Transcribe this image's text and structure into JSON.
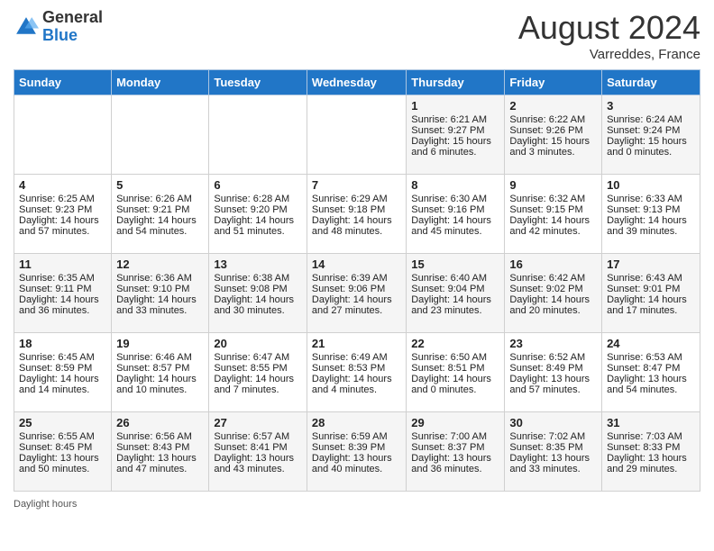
{
  "header": {
    "logo_general": "General",
    "logo_blue": "Blue",
    "month_title": "August 2024",
    "location": "Varreddes, France"
  },
  "days_of_week": [
    "Sunday",
    "Monday",
    "Tuesday",
    "Wednesday",
    "Thursday",
    "Friday",
    "Saturday"
  ],
  "weeks": [
    [
      {
        "day": "",
        "empty": true
      },
      {
        "day": "",
        "empty": true
      },
      {
        "day": "",
        "empty": true
      },
      {
        "day": "",
        "empty": true
      },
      {
        "day": "1",
        "sunrise": "Sunrise: 6:21 AM",
        "sunset": "Sunset: 9:27 PM",
        "daylight": "Daylight: 15 hours and 6 minutes."
      },
      {
        "day": "2",
        "sunrise": "Sunrise: 6:22 AM",
        "sunset": "Sunset: 9:26 PM",
        "daylight": "Daylight: 15 hours and 3 minutes."
      },
      {
        "day": "3",
        "sunrise": "Sunrise: 6:24 AM",
        "sunset": "Sunset: 9:24 PM",
        "daylight": "Daylight: 15 hours and 0 minutes."
      }
    ],
    [
      {
        "day": "4",
        "sunrise": "Sunrise: 6:25 AM",
        "sunset": "Sunset: 9:23 PM",
        "daylight": "Daylight: 14 hours and 57 minutes."
      },
      {
        "day": "5",
        "sunrise": "Sunrise: 6:26 AM",
        "sunset": "Sunset: 9:21 PM",
        "daylight": "Daylight: 14 hours and 54 minutes."
      },
      {
        "day": "6",
        "sunrise": "Sunrise: 6:28 AM",
        "sunset": "Sunset: 9:20 PM",
        "daylight": "Daylight: 14 hours and 51 minutes."
      },
      {
        "day": "7",
        "sunrise": "Sunrise: 6:29 AM",
        "sunset": "Sunset: 9:18 PM",
        "daylight": "Daylight: 14 hours and 48 minutes."
      },
      {
        "day": "8",
        "sunrise": "Sunrise: 6:30 AM",
        "sunset": "Sunset: 9:16 PM",
        "daylight": "Daylight: 14 hours and 45 minutes."
      },
      {
        "day": "9",
        "sunrise": "Sunrise: 6:32 AM",
        "sunset": "Sunset: 9:15 PM",
        "daylight": "Daylight: 14 hours and 42 minutes."
      },
      {
        "day": "10",
        "sunrise": "Sunrise: 6:33 AM",
        "sunset": "Sunset: 9:13 PM",
        "daylight": "Daylight: 14 hours and 39 minutes."
      }
    ],
    [
      {
        "day": "11",
        "sunrise": "Sunrise: 6:35 AM",
        "sunset": "Sunset: 9:11 PM",
        "daylight": "Daylight: 14 hours and 36 minutes."
      },
      {
        "day": "12",
        "sunrise": "Sunrise: 6:36 AM",
        "sunset": "Sunset: 9:10 PM",
        "daylight": "Daylight: 14 hours and 33 minutes."
      },
      {
        "day": "13",
        "sunrise": "Sunrise: 6:38 AM",
        "sunset": "Sunset: 9:08 PM",
        "daylight": "Daylight: 14 hours and 30 minutes."
      },
      {
        "day": "14",
        "sunrise": "Sunrise: 6:39 AM",
        "sunset": "Sunset: 9:06 PM",
        "daylight": "Daylight: 14 hours and 27 minutes."
      },
      {
        "day": "15",
        "sunrise": "Sunrise: 6:40 AM",
        "sunset": "Sunset: 9:04 PM",
        "daylight": "Daylight: 14 hours and 23 minutes."
      },
      {
        "day": "16",
        "sunrise": "Sunrise: 6:42 AM",
        "sunset": "Sunset: 9:02 PM",
        "daylight": "Daylight: 14 hours and 20 minutes."
      },
      {
        "day": "17",
        "sunrise": "Sunrise: 6:43 AM",
        "sunset": "Sunset: 9:01 PM",
        "daylight": "Daylight: 14 hours and 17 minutes."
      }
    ],
    [
      {
        "day": "18",
        "sunrise": "Sunrise: 6:45 AM",
        "sunset": "Sunset: 8:59 PM",
        "daylight": "Daylight: 14 hours and 14 minutes."
      },
      {
        "day": "19",
        "sunrise": "Sunrise: 6:46 AM",
        "sunset": "Sunset: 8:57 PM",
        "daylight": "Daylight: 14 hours and 10 minutes."
      },
      {
        "day": "20",
        "sunrise": "Sunrise: 6:47 AM",
        "sunset": "Sunset: 8:55 PM",
        "daylight": "Daylight: 14 hours and 7 minutes."
      },
      {
        "day": "21",
        "sunrise": "Sunrise: 6:49 AM",
        "sunset": "Sunset: 8:53 PM",
        "daylight": "Daylight: 14 hours and 4 minutes."
      },
      {
        "day": "22",
        "sunrise": "Sunrise: 6:50 AM",
        "sunset": "Sunset: 8:51 PM",
        "daylight": "Daylight: 14 hours and 0 minutes."
      },
      {
        "day": "23",
        "sunrise": "Sunrise: 6:52 AM",
        "sunset": "Sunset: 8:49 PM",
        "daylight": "Daylight: 13 hours and 57 minutes."
      },
      {
        "day": "24",
        "sunrise": "Sunrise: 6:53 AM",
        "sunset": "Sunset: 8:47 PM",
        "daylight": "Daylight: 13 hours and 54 minutes."
      }
    ],
    [
      {
        "day": "25",
        "sunrise": "Sunrise: 6:55 AM",
        "sunset": "Sunset: 8:45 PM",
        "daylight": "Daylight: 13 hours and 50 minutes."
      },
      {
        "day": "26",
        "sunrise": "Sunrise: 6:56 AM",
        "sunset": "Sunset: 8:43 PM",
        "daylight": "Daylight: 13 hours and 47 minutes."
      },
      {
        "day": "27",
        "sunrise": "Sunrise: 6:57 AM",
        "sunset": "Sunset: 8:41 PM",
        "daylight": "Daylight: 13 hours and 43 minutes."
      },
      {
        "day": "28",
        "sunrise": "Sunrise: 6:59 AM",
        "sunset": "Sunset: 8:39 PM",
        "daylight": "Daylight: 13 hours and 40 minutes."
      },
      {
        "day": "29",
        "sunrise": "Sunrise: 7:00 AM",
        "sunset": "Sunset: 8:37 PM",
        "daylight": "Daylight: 13 hours and 36 minutes."
      },
      {
        "day": "30",
        "sunrise": "Sunrise: 7:02 AM",
        "sunset": "Sunset: 8:35 PM",
        "daylight": "Daylight: 13 hours and 33 minutes."
      },
      {
        "day": "31",
        "sunrise": "Sunrise: 7:03 AM",
        "sunset": "Sunset: 8:33 PM",
        "daylight": "Daylight: 13 hours and 29 minutes."
      }
    ]
  ],
  "footer": {
    "daylight_hours_label": "Daylight hours"
  }
}
